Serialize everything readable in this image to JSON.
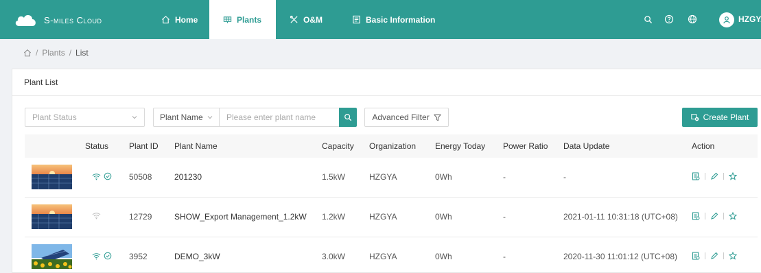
{
  "app": {
    "name": "S-miles Cloud"
  },
  "nav": {
    "home": "Home",
    "plants": "Plants",
    "om": "O&M",
    "basic": "Basic Information"
  },
  "user": {
    "name": "HZGYA"
  },
  "breadcrumb": {
    "root": "Plants",
    "current": "List"
  },
  "card": {
    "title": "Plant List"
  },
  "filters": {
    "status_placeholder": "Plant Status",
    "name_type": "Plant Name",
    "name_placeholder": "Please enter plant name",
    "advanced": "Advanced Filter",
    "create": "Create Plant"
  },
  "table": {
    "headers": {
      "status": "Status",
      "plant_id": "Plant ID",
      "plant_name": "Plant Name",
      "capacity": "Capacity",
      "organization": "Organization",
      "energy_today": "Energy Today",
      "power_ratio": "Power Ratio",
      "data_update": "Data Update",
      "action": "Action"
    },
    "rows": [
      {
        "plant_id": "50508",
        "plant_name": "201230",
        "capacity": "1.5kW",
        "organization": "HZGYA",
        "energy_today": "0Wh",
        "power_ratio": "-",
        "data_update": "-",
        "online": true,
        "checked": true,
        "image": "sunset-panels"
      },
      {
        "plant_id": "12729",
        "plant_name": "SHOW_Export Management_1.2kW",
        "capacity": "1.2kW",
        "organization": "HZGYA",
        "energy_today": "0Wh",
        "power_ratio": "-",
        "data_update": "2021-01-11 10:31:18 (UTC+08)",
        "online": false,
        "checked": false,
        "image": "sunset-panels"
      },
      {
        "plant_id": "3952",
        "plant_name": "DEMO_3kW",
        "capacity": "3.0kW",
        "organization": "HZGYA",
        "energy_today": "0Wh",
        "power_ratio": "-",
        "data_update": "2020-11-30 11:01:12 (UTC+08)",
        "online": true,
        "checked": true,
        "image": "sunflower-panels"
      }
    ]
  },
  "colors": {
    "primary": "#2e9c93",
    "offline": "#bdbdbd"
  },
  "icons": {
    "nav": [
      "home-icon",
      "plants-icon",
      "om-icon",
      "basic-info-icon"
    ],
    "top": [
      "search-icon",
      "help-icon",
      "globe-icon",
      "user-icon"
    ],
    "actions": [
      "report-icon",
      "edit-icon",
      "star-icon"
    ]
  }
}
